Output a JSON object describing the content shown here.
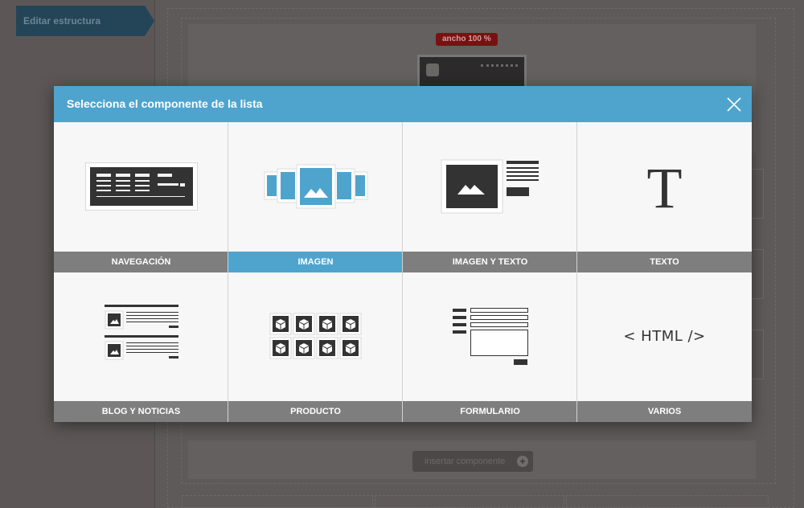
{
  "sidebar": {
    "tab_label": "Editar estructura"
  },
  "editor": {
    "width_badge": "ancho 100 %",
    "insert_button_label": "insertar componente",
    "insert_icon": "plus-circle-icon"
  },
  "modal": {
    "title": "Selecciona el componente de la lista",
    "close_icon": "close-icon",
    "accent_color": "#4fa4ce",
    "label_bar_color": "#7e7e7e",
    "components": [
      {
        "label": "NAVEGACIÓN",
        "icon": "navigation-icon",
        "selected": false
      },
      {
        "label": "IMAGEN",
        "icon": "image-carousel-icon",
        "selected": true
      },
      {
        "label": "IMAGEN Y TEXTO",
        "icon": "image-text-icon",
        "selected": false
      },
      {
        "label": "TEXTO",
        "icon": "text-icon",
        "glyph": "T",
        "selected": false
      },
      {
        "label": "BLOG Y NOTICIAS",
        "icon": "blog-icon",
        "selected": false
      },
      {
        "label": "PRODUCTO",
        "icon": "product-grid-icon",
        "selected": false
      },
      {
        "label": "FORMULARIO",
        "icon": "form-icon",
        "selected": false
      },
      {
        "label": "VARIOS",
        "icon": "html-code-icon",
        "glyph": "< HTML />",
        "selected": false
      }
    ]
  }
}
